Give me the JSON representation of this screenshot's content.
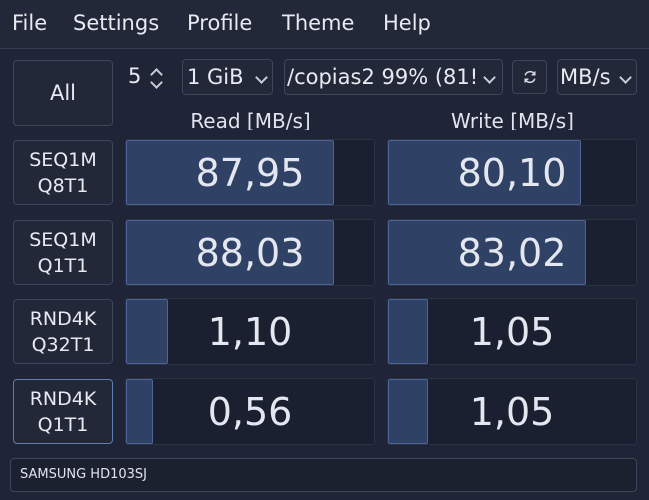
{
  "menu": [
    "File",
    "Settings",
    "Profile",
    "Theme",
    "Help"
  ],
  "controls": {
    "all_label": "All",
    "count": "5",
    "size": "1 GiB",
    "drive": "/copias2 99% (81!",
    "refresh_icon": "refresh-icon",
    "unit": "MB/s"
  },
  "headers": {
    "read": "Read [MB/s]",
    "write": "Write [MB/s]"
  },
  "tests": [
    {
      "line1": "SEQ1M",
      "line2": "Q8T1",
      "read": "87,95",
      "write": "80,10",
      "read_fill": 0.84,
      "write_fill": 0.78
    },
    {
      "line1": "SEQ1M",
      "line2": "Q1T1",
      "read": "88,03",
      "write": "83,02",
      "read_fill": 0.84,
      "write_fill": 0.8
    },
    {
      "line1": "RND4K",
      "line2": "Q32T1",
      "read": "1,10",
      "write": "1,05",
      "read_fill": 0.17,
      "write_fill": 0.16
    },
    {
      "line1": "RND4K",
      "line2": "Q1T1",
      "read": "0,56",
      "write": "1,05",
      "read_fill": 0.11,
      "write_fill": 0.16
    }
  ],
  "status": "SAMSUNG HD103SJ"
}
